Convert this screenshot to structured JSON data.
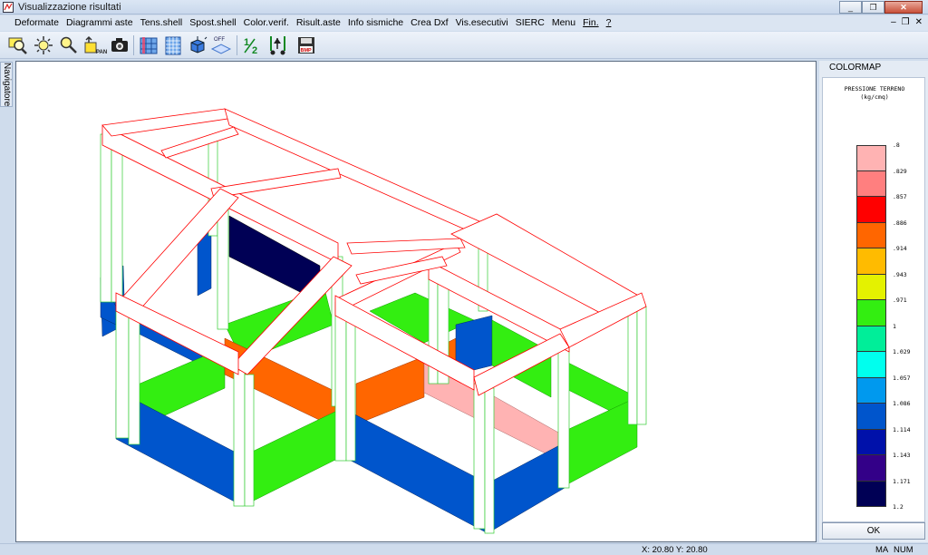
{
  "window": {
    "title": "Visualizzazione risultati",
    "buttons": [
      "_",
      "❐",
      "✕"
    ]
  },
  "menu": {
    "items": [
      "Deformate",
      "Diagrammi aste",
      "Tens.shell",
      "Spost.shell",
      "Color.verif.",
      "Risult.aste",
      "Info sismiche",
      "Crea Dxf",
      "Vis.esecutivi",
      "SIERC",
      "Menu",
      "Fin.",
      "?"
    ],
    "mdi_buttons": [
      "–",
      "❐",
      "✕"
    ]
  },
  "toolbar": {
    "icons": [
      "zoom-window-icon",
      "pan-icon",
      "zoom-icon",
      "zoom-dynamic-icon",
      "camera-icon",
      "frame-front-icon",
      "frame-grid-icon",
      "view-3d-icon",
      "off-toggle-icon",
      "fraction-icon",
      "measure-icon",
      "save-bmp-icon"
    ],
    "off_label": "OFF",
    "bmp_label": "BMP"
  },
  "navigator": {
    "label": "Navigatore"
  },
  "colormap": {
    "header": "COLORMAP",
    "title_line1": "PRESSIONE TERRENO",
    "title_line2": "(kg/cmq)",
    "colors": [
      "#ffb3b3",
      "#ff7f7f",
      "#ff0000",
      "#ff6600",
      "#ffbb00",
      "#e4f200",
      "#33ee11",
      "#00ee99",
      "#00ffee",
      "#0099ee",
      "#0055cc",
      "#0011aa",
      "#330088",
      "#000055"
    ],
    "ticks": [
      ".8",
      ".829",
      ".857",
      ".886",
      ".914",
      ".943",
      ".971",
      "1",
      "1.029",
      "1.057",
      "1.086",
      "1.114",
      "1.143",
      "1.171",
      "1.2"
    ],
    "ok_label": "OK"
  },
  "status": {
    "coords": "X: 20.80   Y: 20.80",
    "ma": "MA",
    "num": "NUM"
  },
  "scene": {
    "colors": {
      "beam": "#ff0000",
      "column": "#33cc33",
      "blue": "#0055cc",
      "green": "#33ee11",
      "navy": "#000055",
      "orange": "#ff6600",
      "pink": "#ffb3b3"
    }
  }
}
